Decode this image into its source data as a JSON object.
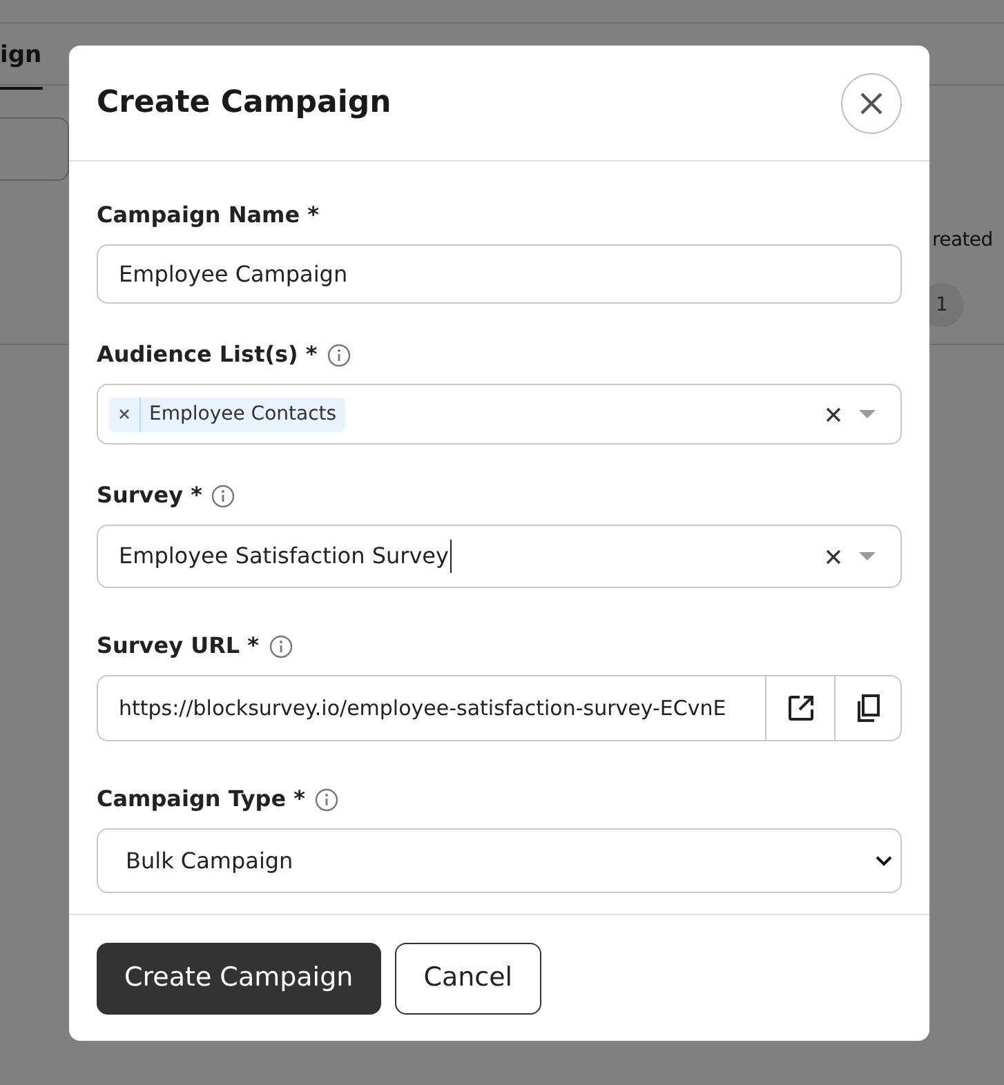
{
  "background": {
    "tabs": [
      {
        "label": "ign",
        "selected": true
      }
    ],
    "column_header": "reated",
    "page_badge": "1"
  },
  "dialog": {
    "title": "Create Campaign",
    "fields": [
      {
        "kind": "text",
        "label": "Campaign Name *",
        "info": false,
        "value": "Employee Campaign"
      },
      {
        "kind": "multiselect",
        "label": "Audience List(s) *",
        "info": true,
        "tags": [
          "Employee Contacts"
        ]
      },
      {
        "kind": "combo",
        "label": "Survey *",
        "info": true,
        "value": "Employee Satisfaction Survey"
      },
      {
        "kind": "url",
        "label": "Survey URL *",
        "info": true,
        "value": "https://blocksurvey.io/employee-satisfaction-survey-ECvnE"
      },
      {
        "kind": "select",
        "label": "Campaign Type *",
        "info": true,
        "value": "Bulk Campaign"
      }
    ],
    "buttons": [
      {
        "label": "Create Campaign",
        "kind": "primary"
      },
      {
        "label": "Cancel",
        "kind": "secondary"
      }
    ]
  }
}
